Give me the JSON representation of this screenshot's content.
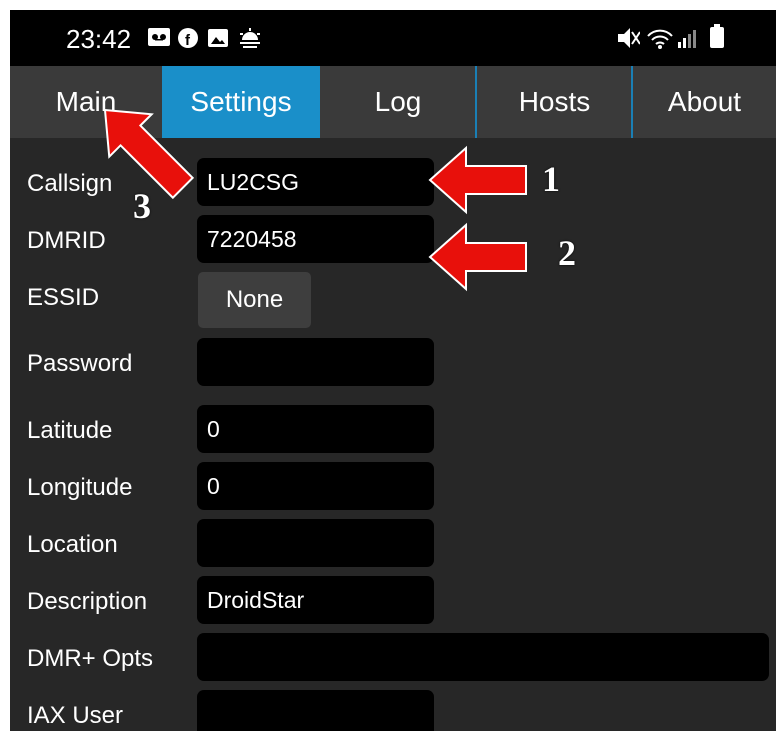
{
  "status_bar": {
    "time": "23:42",
    "left_icons": [
      "voicemail-icon",
      "facebook-icon",
      "gallery-icon",
      "weather-icon"
    ],
    "right_icons": [
      "mute-icon",
      "wifi-icon",
      "signal-icon",
      "battery-icon"
    ]
  },
  "tabs": [
    {
      "label": "Main",
      "active": false
    },
    {
      "label": "Settings",
      "active": true
    },
    {
      "label": "Log",
      "active": false
    },
    {
      "label": "Hosts",
      "active": false
    },
    {
      "label": "About",
      "active": false
    }
  ],
  "settings": {
    "callsign": {
      "label": "Callsign",
      "value": "LU2CSG"
    },
    "dmrid": {
      "label": "DMRID",
      "value": "7220458"
    },
    "essid": {
      "label": "ESSID",
      "value": "None"
    },
    "password": {
      "label": "Password",
      "value": ""
    },
    "latitude": {
      "label": "Latitude",
      "value": "0"
    },
    "longitude": {
      "label": "Longitude",
      "value": "0"
    },
    "location": {
      "label": "Location",
      "value": ""
    },
    "description": {
      "label": "Description",
      "value": "DroidStar"
    },
    "dmr_opts": {
      "label": "DMR+ Opts",
      "value": ""
    },
    "iax_user": {
      "label": "IAX User",
      "value": ""
    }
  },
  "annotations": {
    "one": "1",
    "two": "2",
    "three": "3",
    "arrow_color": "#e8100b"
  },
  "colors": {
    "accent": "#1a8fc9",
    "background": "#272727",
    "field": "#000000"
  }
}
